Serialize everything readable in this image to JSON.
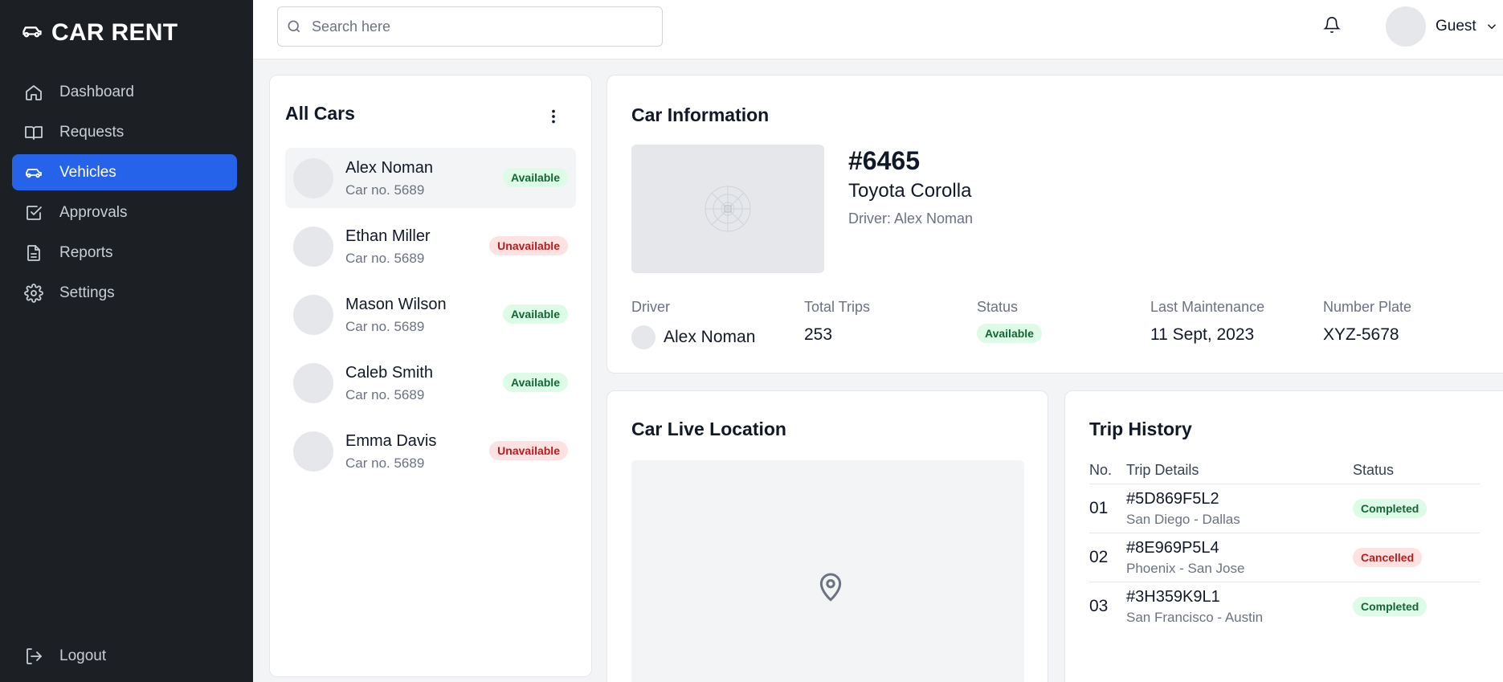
{
  "brand": {
    "name": "CAR RENT",
    "icon": "car-icon"
  },
  "sidebar": {
    "items": [
      {
        "label": "Dashboard",
        "icon": "home-icon"
      },
      {
        "label": "Requests",
        "icon": "book-icon"
      },
      {
        "label": "Vehicles",
        "icon": "car-icon",
        "active": true
      },
      {
        "label": "Approvals",
        "icon": "check-square-icon"
      },
      {
        "label": "Reports",
        "icon": "document-icon"
      },
      {
        "label": "Settings",
        "icon": "gear-icon"
      }
    ],
    "logout_label": "Logout"
  },
  "topbar": {
    "search_placeholder": "Search here",
    "user_name": "Guest"
  },
  "all_cars": {
    "title": "All Cars",
    "items": [
      {
        "name": "Alex Noman",
        "car_no": "Car no. 5689",
        "status": "Available"
      },
      {
        "name": "Ethan Miller",
        "car_no": "Car no. 5689",
        "status": "Unavailable"
      },
      {
        "name": "Mason Wilson",
        "car_no": "Car no. 5689",
        "status": "Available"
      },
      {
        "name": "Caleb Smith",
        "car_no": "Car no. 5689",
        "status": "Available"
      },
      {
        "name": "Emma Davis",
        "car_no": "Car no. 5689",
        "status": "Unavailable"
      }
    ]
  },
  "car_info": {
    "title": "Car Information",
    "id": "#6465",
    "model": "Toyota Corolla",
    "driver_line": "Driver: Alex Noman",
    "driver_label": "Driver",
    "driver_value": "Alex Noman",
    "trips_label": "Total Trips",
    "trips_value": "253",
    "status_label": "Status",
    "status_value": "Available",
    "maintenance_label": "Last Maintenance",
    "maintenance_value": "11 Sept, 2023",
    "plate_label": "Number Plate",
    "plate_value": "XYZ-5678"
  },
  "live_location": {
    "title": "Car Live Location"
  },
  "trip_history": {
    "title": "Trip History",
    "columns": [
      "No.",
      "Trip Details",
      "Status"
    ],
    "rows": [
      {
        "no": "01",
        "id": "#5D869F5L2",
        "route": "San Diego - Dallas",
        "status": "Completed"
      },
      {
        "no": "02",
        "id": "#8E969P5L4",
        "route": "Phoenix - San Jose",
        "status": "Cancelled"
      },
      {
        "no": "03",
        "id": "#3H359K9L1",
        "route": "San Francisco - Austin",
        "status": "Completed"
      }
    ]
  },
  "colors": {
    "sidebar_bg": "#1c2024",
    "accent": "#2563eb",
    "available_bg": "#dcfce7",
    "available_text": "#166534",
    "unavailable_bg": "#fee2e2",
    "unavailable_text": "#b91c1c"
  }
}
